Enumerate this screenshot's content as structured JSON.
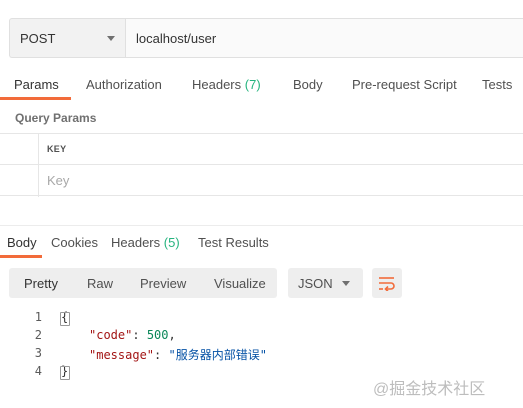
{
  "request": {
    "method": "POST",
    "url": "localhost/user"
  },
  "request_tabs": [
    {
      "label": "Params",
      "active": true
    },
    {
      "label": "Authorization"
    },
    {
      "label": "Headers",
      "count": "(7)"
    },
    {
      "label": "Body"
    },
    {
      "label": "Pre-request Script"
    },
    {
      "label": "Tests"
    }
  ],
  "query_params": {
    "title": "Query Params",
    "key_header": "KEY",
    "key_placeholder": "Key"
  },
  "response_tabs": [
    {
      "label": "Body",
      "active": true
    },
    {
      "label": "Cookies"
    },
    {
      "label": "Headers",
      "count": "(5)"
    },
    {
      "label": "Test Results"
    }
  ],
  "view_modes": [
    "Pretty",
    "Raw",
    "Preview",
    "Visualize"
  ],
  "format": "JSON",
  "response_body": {
    "line_numbers": [
      "1",
      "2",
      "3",
      "4"
    ],
    "open_brace": "{",
    "code_key": "\"code\"",
    "code_value": "500",
    "message_key": "\"message\"",
    "message_value": "\"服务器内部错误\"",
    "close_brace": "}"
  },
  "watermark": "@掘金技术社区",
  "colors": {
    "accent": "#f26b3a",
    "count_green": "#26b47f"
  }
}
